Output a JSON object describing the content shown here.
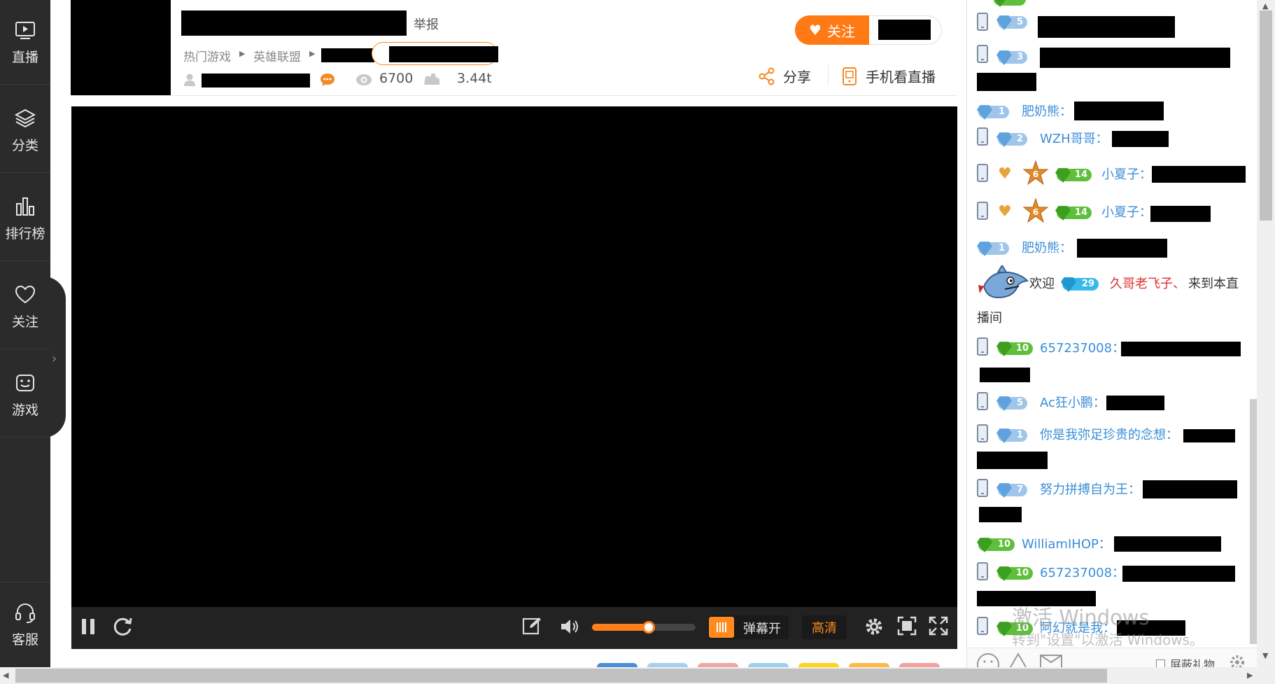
{
  "sidebar": {
    "items": [
      {
        "label": "直播",
        "icon": "play-screen-icon"
      },
      {
        "label": "分类",
        "icon": "layers-icon"
      },
      {
        "label": "排行榜",
        "icon": "bar-chart-icon"
      },
      {
        "label": "关注",
        "icon": "heart-icon"
      },
      {
        "label": "游戏",
        "icon": "gamepad-face-icon"
      }
    ],
    "help_label": "客服"
  },
  "header": {
    "report_label": "举报",
    "breadcrumb": [
      "热门游戏",
      "英雄联盟"
    ],
    "viewers": "6700",
    "weight": "3.44t",
    "follow_label": "关注",
    "share_label": "分享",
    "mobile_label": "手机看直播"
  },
  "player": {
    "danmaku_label": "弹幕开",
    "quality_label": "高清",
    "volume_percent": 55,
    "accent_color": "#ff7f1a"
  },
  "chat": {
    "messages": [
      {
        "user": "",
        "level": "5"
      },
      {
        "user": "",
        "level": "3"
      },
      {
        "user": "肥奶熊：",
        "level": "1"
      },
      {
        "user": "WZH哥哥：",
        "level": "2"
      },
      {
        "user": "小夏子：",
        "level": "14"
      },
      {
        "user": "小夏子：",
        "level": "14"
      },
      {
        "user": "肥奶熊：",
        "level": "1"
      },
      {
        "user": "657237008：",
        "level": "10"
      },
      {
        "user": "Ac狂小鹏：",
        "level": "5"
      },
      {
        "user": "你是我弥足珍贵的念想：",
        "level": "1"
      },
      {
        "user": "努力拼搏自为王：",
        "level": "7"
      },
      {
        "user": "WilliamIHOP：",
        "level": "10"
      },
      {
        "user": "657237008：",
        "level": "10"
      },
      {
        "user": "阿幻就是我：",
        "level": "10"
      }
    ],
    "welcome": {
      "prefix": "欢迎",
      "level": "29",
      "user": "久哥老飞子、",
      "suffix_1": "来到本直",
      "suffix_2": "播间"
    },
    "shield_gift_label": "屏蔽礼物",
    "username_color": "#3b8ed8"
  },
  "watermark": {
    "line1": "激活 Windows",
    "line2": "转到\"设置\"以激活 Windows。"
  }
}
